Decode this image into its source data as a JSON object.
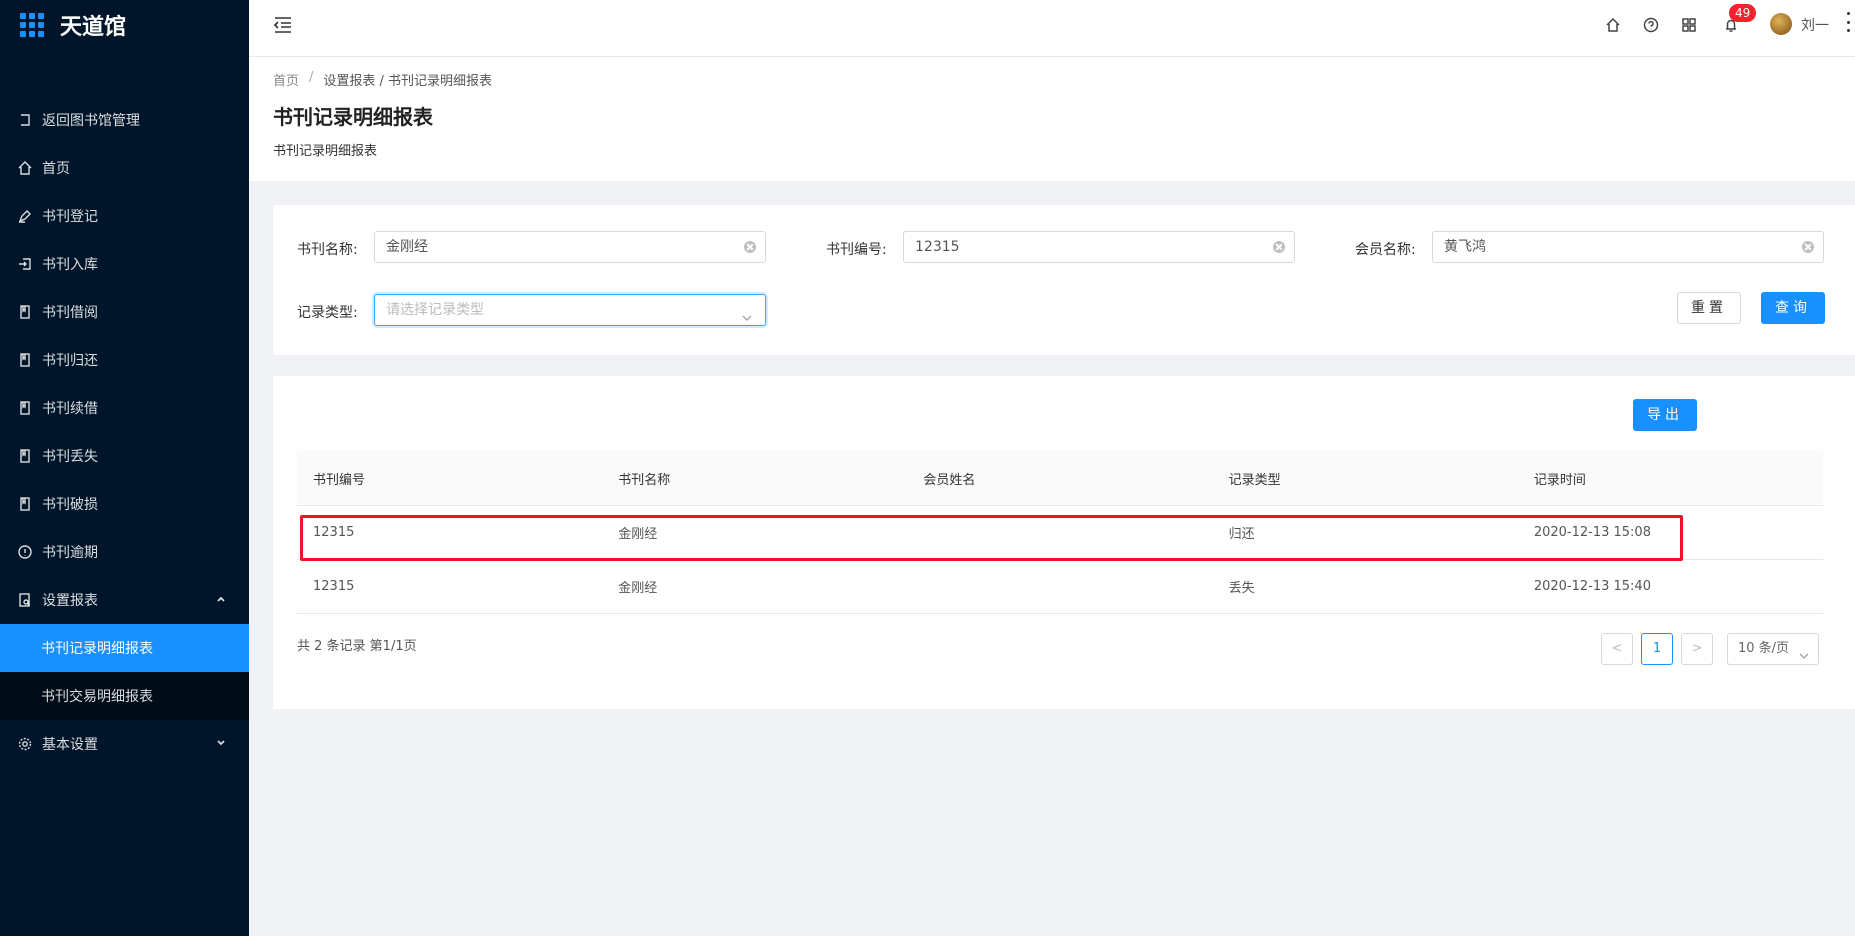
{
  "app": {
    "title": "天道馆"
  },
  "sidebar": {
    "items": [
      {
        "label": "返回图书馆管理",
        "icon": "back-icon"
      },
      {
        "label": "首页",
        "icon": "home-icon"
      },
      {
        "label": "书刊登记",
        "icon": "pen-icon"
      },
      {
        "label": "书刊入库",
        "icon": "import-icon"
      },
      {
        "label": "书刊借阅",
        "icon": "book-icon"
      },
      {
        "label": "书刊归还",
        "icon": "book-icon"
      },
      {
        "label": "书刊续借",
        "icon": "book-icon"
      },
      {
        "label": "书刊丢失",
        "icon": "book-icon"
      },
      {
        "label": "书刊破损",
        "icon": "book-icon"
      },
      {
        "label": "书刊逾期",
        "icon": "info-circle-icon"
      },
      {
        "label": "设置报表",
        "icon": "report-icon"
      }
    ],
    "submenu": [
      {
        "label": "书刊记录明细报表",
        "active": true
      },
      {
        "label": "书刊交易明细报表",
        "active": false
      }
    ],
    "basic_settings": {
      "label": "基本设置",
      "icon": "gear-icon"
    }
  },
  "header": {
    "notification_count": "49",
    "username": "刘一"
  },
  "breadcrumb": {
    "home": "首页",
    "sep": "/",
    "trail": "设置报表 / 书刊记录明细报表"
  },
  "page": {
    "title": "书刊记录明细报表",
    "description": "书刊记录明细报表"
  },
  "search": {
    "book_name_label": "书刊名称:",
    "book_name_value": "金刚经",
    "book_no_label": "书刊编号:",
    "book_no_value": "12315",
    "member_label": "会员名称:",
    "member_value": "黄飞鸿",
    "record_type_label": "记录类型:",
    "record_type_placeholder": "请选择记录类型",
    "reset_label": "重置",
    "query_label": "查询"
  },
  "table": {
    "export_label": "导出",
    "columns": [
      "书刊编号",
      "书刊名称",
      "会员姓名",
      "记录类型",
      "记录时间"
    ],
    "rows": [
      [
        "12315",
        "金刚经",
        "",
        "归还",
        "2020-12-13 15:08"
      ],
      [
        "12315",
        "金刚经",
        "",
        "丢失",
        "2020-12-13 15:40"
      ]
    ],
    "total_text": "共 2 条记录 第1/1页",
    "current_page": "1",
    "page_size": "10 条/页",
    "prev": "<",
    "next": ">"
  },
  "colors": {
    "sidebar_bg": "#001529",
    "accent": "#1890ff",
    "highlight": "#e8182a",
    "badge": "#f5222d"
  }
}
